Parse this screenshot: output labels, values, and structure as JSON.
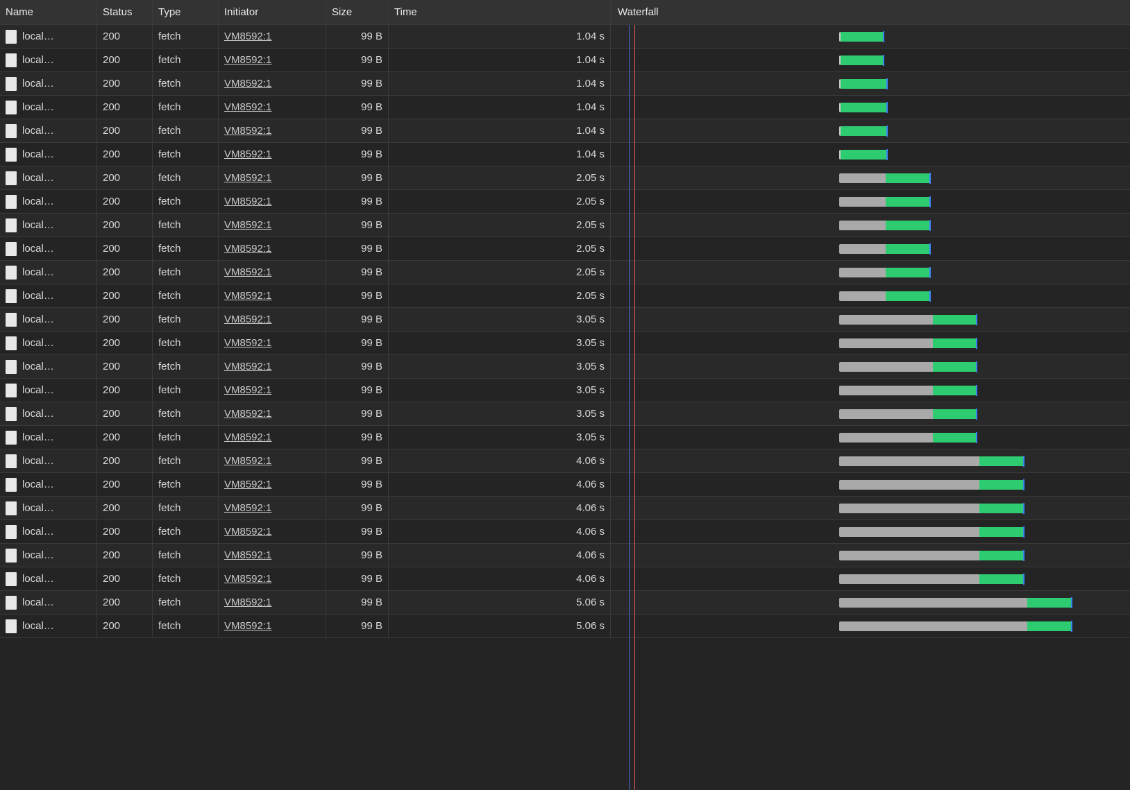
{
  "columns": {
    "name": "Name",
    "status": "Status",
    "type": "Type",
    "initiator": "Initiator",
    "size": "Size",
    "time": "Time",
    "waterfall": "Waterfall"
  },
  "waterfall": {
    "total_seconds": 6.5,
    "marker_blue_s": 0.05,
    "marker_red_s": 0.12
  },
  "rows": [
    {
      "name": "local…",
      "status": "200",
      "type": "fetch",
      "initiator": "VM8592:1",
      "size": "99 B",
      "time": "1.04 s",
      "start_s": 0.02,
      "wait_s": 0.02,
      "dl_s": 0.33
    },
    {
      "name": "local…",
      "status": "200",
      "type": "fetch",
      "initiator": "VM8592:1",
      "size": "99 B",
      "time": "1.04 s",
      "start_s": 0.02,
      "wait_s": 0.02,
      "dl_s": 0.33
    },
    {
      "name": "local…",
      "status": "200",
      "type": "fetch",
      "initiator": "VM8592:1",
      "size": "99 B",
      "time": "1.04 s",
      "start_s": 0.02,
      "wait_s": 0.02,
      "dl_s": 0.36
    },
    {
      "name": "local…",
      "status": "200",
      "type": "fetch",
      "initiator": "VM8592:1",
      "size": "99 B",
      "time": "1.04 s",
      "start_s": 0.02,
      "wait_s": 0.02,
      "dl_s": 0.36
    },
    {
      "name": "local…",
      "status": "200",
      "type": "fetch",
      "initiator": "VM8592:1",
      "size": "99 B",
      "time": "1.04 s",
      "start_s": 0.02,
      "wait_s": 0.02,
      "dl_s": 0.36
    },
    {
      "name": "local…",
      "status": "200",
      "type": "fetch",
      "initiator": "VM8592:1",
      "size": "99 B",
      "time": "1.04 s",
      "start_s": 0.02,
      "wait_s": 0.02,
      "dl_s": 0.36
    },
    {
      "name": "local…",
      "status": "200",
      "type": "fetch",
      "initiator": "VM8592:1",
      "size": "99 B",
      "time": "2.05 s",
      "start_s": 0.02,
      "wait_s": 0.36,
      "dl_s": 0.34
    },
    {
      "name": "local…",
      "status": "200",
      "type": "fetch",
      "initiator": "VM8592:1",
      "size": "99 B",
      "time": "2.05 s",
      "start_s": 0.02,
      "wait_s": 0.36,
      "dl_s": 0.34
    },
    {
      "name": "local…",
      "status": "200",
      "type": "fetch",
      "initiator": "VM8592:1",
      "size": "99 B",
      "time": "2.05 s",
      "start_s": 0.02,
      "wait_s": 0.36,
      "dl_s": 0.34
    },
    {
      "name": "local…",
      "status": "200",
      "type": "fetch",
      "initiator": "VM8592:1",
      "size": "99 B",
      "time": "2.05 s",
      "start_s": 0.02,
      "wait_s": 0.36,
      "dl_s": 0.34
    },
    {
      "name": "local…",
      "status": "200",
      "type": "fetch",
      "initiator": "VM8592:1",
      "size": "99 B",
      "time": "2.05 s",
      "start_s": 0.02,
      "wait_s": 0.36,
      "dl_s": 0.34
    },
    {
      "name": "local…",
      "status": "200",
      "type": "fetch",
      "initiator": "VM8592:1",
      "size": "99 B",
      "time": "2.05 s",
      "start_s": 0.02,
      "wait_s": 0.36,
      "dl_s": 0.34
    },
    {
      "name": "local…",
      "status": "200",
      "type": "fetch",
      "initiator": "VM8592:1",
      "size": "99 B",
      "time": "3.05 s",
      "start_s": 0.02,
      "wait_s": 0.72,
      "dl_s": 0.34
    },
    {
      "name": "local…",
      "status": "200",
      "type": "fetch",
      "initiator": "VM8592:1",
      "size": "99 B",
      "time": "3.05 s",
      "start_s": 0.02,
      "wait_s": 0.72,
      "dl_s": 0.34
    },
    {
      "name": "local…",
      "status": "200",
      "type": "fetch",
      "initiator": "VM8592:1",
      "size": "99 B",
      "time": "3.05 s",
      "start_s": 0.02,
      "wait_s": 0.72,
      "dl_s": 0.34
    },
    {
      "name": "local…",
      "status": "200",
      "type": "fetch",
      "initiator": "VM8592:1",
      "size": "99 B",
      "time": "3.05 s",
      "start_s": 0.02,
      "wait_s": 0.72,
      "dl_s": 0.34
    },
    {
      "name": "local…",
      "status": "200",
      "type": "fetch",
      "initiator": "VM8592:1",
      "size": "99 B",
      "time": "3.05 s",
      "start_s": 0.02,
      "wait_s": 0.72,
      "dl_s": 0.34
    },
    {
      "name": "local…",
      "status": "200",
      "type": "fetch",
      "initiator": "VM8592:1",
      "size": "99 B",
      "time": "3.05 s",
      "start_s": 0.02,
      "wait_s": 0.72,
      "dl_s": 0.34
    },
    {
      "name": "local…",
      "status": "200",
      "type": "fetch",
      "initiator": "VM8592:1",
      "size": "99 B",
      "time": "4.06 s",
      "start_s": 0.02,
      "wait_s": 1.08,
      "dl_s": 0.34
    },
    {
      "name": "local…",
      "status": "200",
      "type": "fetch",
      "initiator": "VM8592:1",
      "size": "99 B",
      "time": "4.06 s",
      "start_s": 0.02,
      "wait_s": 1.08,
      "dl_s": 0.34
    },
    {
      "name": "local…",
      "status": "200",
      "type": "fetch",
      "initiator": "VM8592:1",
      "size": "99 B",
      "time": "4.06 s",
      "start_s": 0.02,
      "wait_s": 1.08,
      "dl_s": 0.34
    },
    {
      "name": "local…",
      "status": "200",
      "type": "fetch",
      "initiator": "VM8592:1",
      "size": "99 B",
      "time": "4.06 s",
      "start_s": 0.02,
      "wait_s": 1.08,
      "dl_s": 0.34
    },
    {
      "name": "local…",
      "status": "200",
      "type": "fetch",
      "initiator": "VM8592:1",
      "size": "99 B",
      "time": "4.06 s",
      "start_s": 0.02,
      "wait_s": 1.08,
      "dl_s": 0.34
    },
    {
      "name": "local…",
      "status": "200",
      "type": "fetch",
      "initiator": "VM8592:1",
      "size": "99 B",
      "time": "4.06 s",
      "start_s": 0.02,
      "wait_s": 1.08,
      "dl_s": 0.34
    },
    {
      "name": "local…",
      "status": "200",
      "type": "fetch",
      "initiator": "VM8592:1",
      "size": "99 B",
      "time": "5.06 s",
      "start_s": 0.02,
      "wait_s": 1.45,
      "dl_s": 0.34
    },
    {
      "name": "local…",
      "status": "200",
      "type": "fetch",
      "initiator": "VM8592:1",
      "size": "99 B",
      "time": "5.06 s",
      "start_s": 0.02,
      "wait_s": 1.45,
      "dl_s": 0.34
    }
  ]
}
